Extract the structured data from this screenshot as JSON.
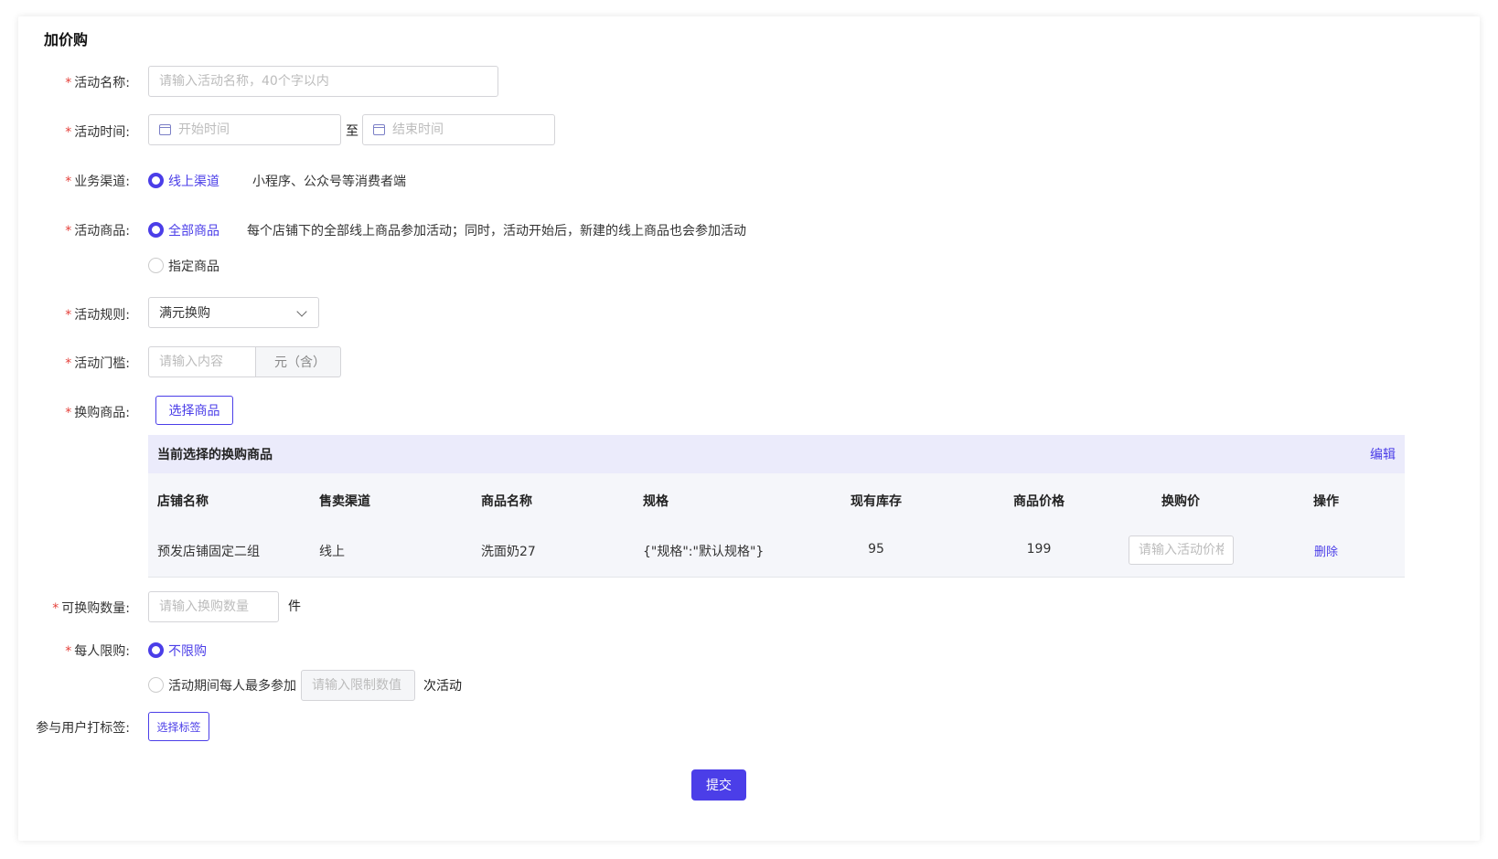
{
  "page": {
    "title": "加价购"
  },
  "form": {
    "name": {
      "label": "活动名称:",
      "placeholder": "请输入活动名称，40个字以内"
    },
    "time": {
      "label": "活动时间:",
      "start_placeholder": "开始时间",
      "sep": "至",
      "end_placeholder": "结束时间"
    },
    "channel": {
      "label": "业务渠道:",
      "option": "线上渠道",
      "hint": "小程序、公众号等消费者端"
    },
    "goods": {
      "label": "活动商品:",
      "option_all": "全部商品",
      "hint": "每个店铺下的全部线上商品参加活动；同时，活动开始后，新建的线上商品也会参加活动",
      "option_specified": "指定商品"
    },
    "rule": {
      "label": "活动规则:",
      "value": "满元换购"
    },
    "threshold": {
      "label": "活动门槛:",
      "placeholder": "请输入内容",
      "addon": "元（含）"
    },
    "exchange_goods": {
      "label": "换购商品:",
      "button": "选择商品"
    },
    "table": {
      "title": "当前选择的换购商品",
      "edit": "编辑",
      "headers": [
        "店铺名称",
        "售卖渠道",
        "商品名称",
        "规格",
        "现有库存",
        "商品价格",
        "换购价",
        "操作"
      ],
      "rows": [
        {
          "shop": "预发店铺固定二组",
          "channel": "线上",
          "name": "洗面奶27",
          "spec": "{\"规格\":\"默认规格\"}",
          "stock": "95",
          "price": "199",
          "price_placeholder": "请输入活动价格",
          "action": "删除"
        }
      ]
    },
    "quantity": {
      "label": "可换购数量:",
      "placeholder": "请输入换购数量",
      "unit": "件"
    },
    "limit": {
      "label": "每人限购:",
      "option_none": "不限购",
      "option_max": "活动期间每人最多参加",
      "placeholder": "请输入限制数值",
      "suffix": "次活动"
    },
    "tags": {
      "label": "参与用户打标签:",
      "button": "选择标签"
    },
    "submit": "提交"
  },
  "colors": {
    "primary": "#4b3ee8",
    "required": "#e5413b",
    "table_header_bg": "#ebebfb"
  }
}
